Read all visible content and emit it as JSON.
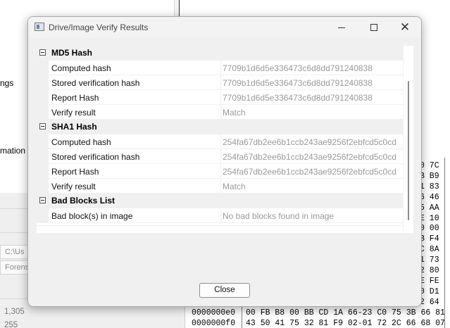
{
  "background": {
    "side_labels": [
      "ngs",
      "mation"
    ],
    "path_rows": [
      "C:\\Us",
      "Forens"
    ],
    "numbers": [
      "1,305",
      "255"
    ],
    "hex_view": {
      "rows": [
        {
          "offset": "",
          "bytes": "",
          "tail": "0 7C "
        },
        {
          "offset": "",
          "bytes": "",
          "tail": "B B9 "
        },
        {
          "offset": "",
          "bytes": "",
          "tail": "1 83 "
        },
        {
          "offset": "",
          "bytes": "",
          "tail": "6 46 "
        },
        {
          "offset": "",
          "bytes": "",
          "tail": "5 AA "
        },
        {
          "offset": "",
          "bytes": "",
          "tail": "E 10 "
        },
        {
          "offset": "",
          "bytes": "",
          "tail": "0 00 "
        },
        {
          "offset": "",
          "bytes": "",
          "tail": "B F4 "
        },
        {
          "offset": "",
          "bytes": "",
          "tail": "C 8A "
        },
        {
          "offset": "",
          "bytes": "",
          "tail": "1 73 "
        },
        {
          "offset": "",
          "bytes": "",
          "tail": "2 80 "
        },
        {
          "offset": "",
          "bytes": "",
          "tail": "E FE "
        },
        {
          "offset": "",
          "bytes": "",
          "tail": "0 D1 "
        },
        {
          "offset": "",
          "bytes": "",
          "tail": "2 64 "
        },
        {
          "offset": "0000000e0",
          "bytes": "00 FB B8 00 BB CD 1A 66-23 C0 75 3B 66 81",
          "tail": ""
        },
        {
          "offset": "0000000f0",
          "bytes": "43 50 41 75 32 81 F9 02-01 72 2C 66 68 07",
          "tail": ""
        }
      ]
    }
  },
  "dialog": {
    "title": "Drive/Image Verify Results",
    "icon": "app-window-icon",
    "controls": {
      "minimize": "minimize-icon",
      "maximize": "maximize-icon",
      "close": "close-icon"
    },
    "sections": [
      {
        "title": "MD5 Hash",
        "rows": [
          {
            "name": "Computed hash",
            "value": "7709b1d6d5e336473c6d8dd791240838"
          },
          {
            "name": "Stored verification hash",
            "value": "7709b1d6d5e336473c6d8dd791240838"
          },
          {
            "name": "Report Hash",
            "value": "7709b1d6d5e336473c6d8dd791240838"
          },
          {
            "name": "Verify result",
            "value": "Match"
          }
        ]
      },
      {
        "title": "SHA1 Hash",
        "rows": [
          {
            "name": "Computed hash",
            "value": "254fa67db2ee6b1ccb243ae9256f2ebfcd5c0cd"
          },
          {
            "name": "Stored verification hash",
            "value": "254fa67db2ee6b1ccb243ae9256f2ebfcd5c0cd"
          },
          {
            "name": "Report Hash",
            "value": "254fa67db2ee6b1ccb243ae9256f2ebfcd5c0cd"
          },
          {
            "name": "Verify result",
            "value": "Match"
          }
        ]
      },
      {
        "title": "Bad Blocks List",
        "rows": [
          {
            "name": "Bad block(s) in image",
            "value": "No bad blocks found in image"
          }
        ]
      }
    ],
    "close_label": "Close"
  }
}
